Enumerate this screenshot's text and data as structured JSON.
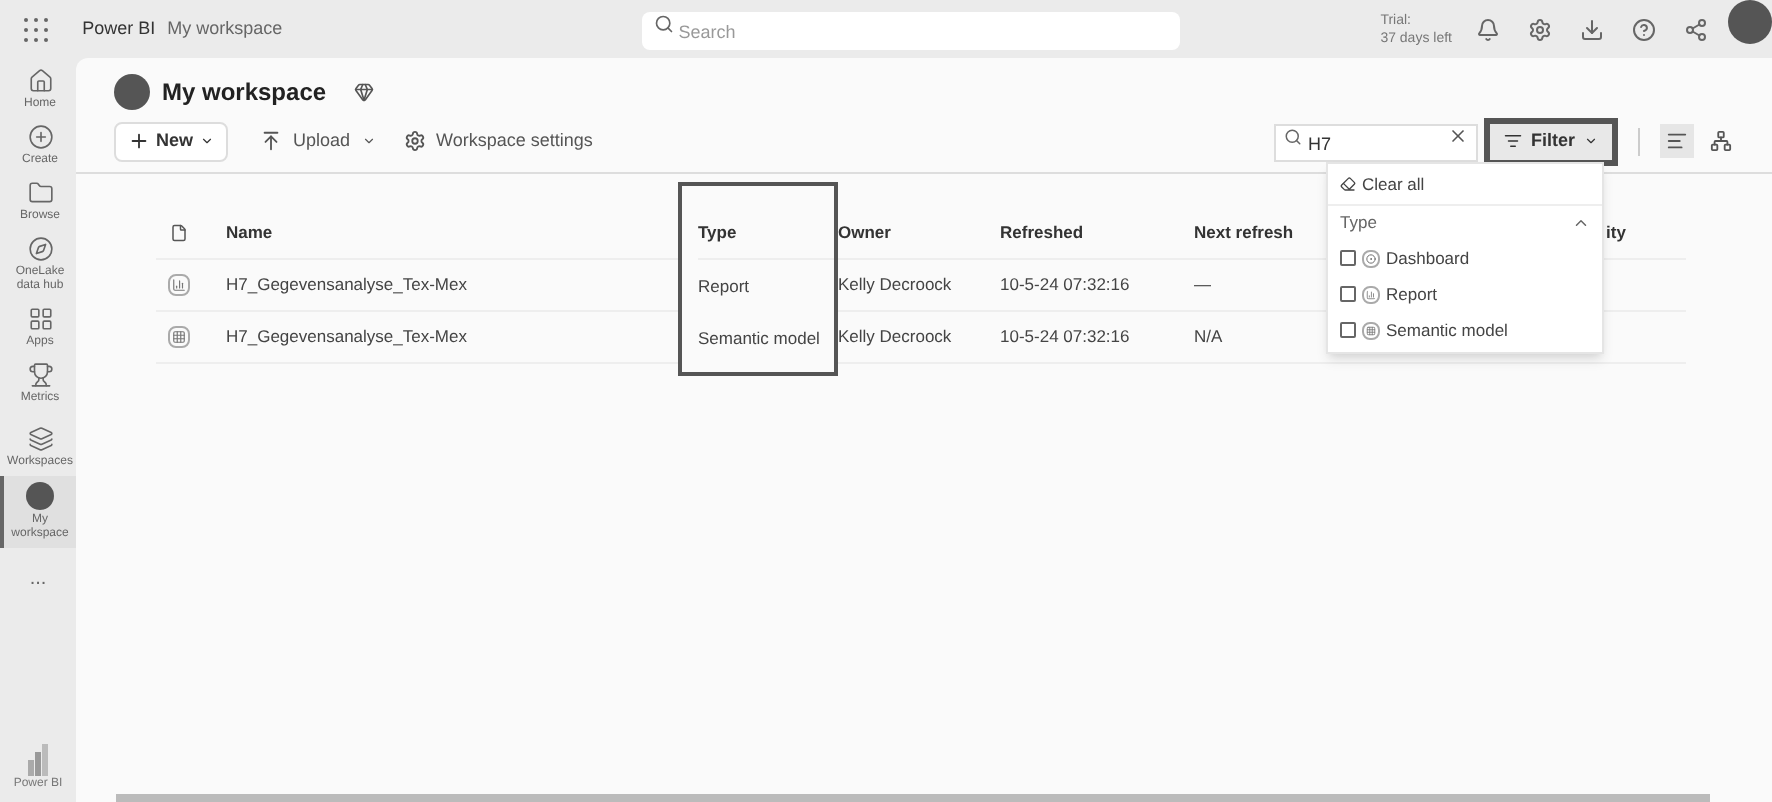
{
  "topbar": {
    "brand": "Power BI",
    "breadcrumb": "My workspace",
    "search_placeholder": "Search",
    "trial": [
      "Trial:",
      "37 days left"
    ]
  },
  "rail": [
    {
      "label": "Home",
      "selected": false
    },
    {
      "label": "Create",
      "selected": false
    },
    {
      "label": "Browse",
      "selected": false
    },
    {
      "label": "OneLake data hub",
      "selected": false
    },
    {
      "label": "Apps",
      "selected": false
    },
    {
      "label": "Metrics",
      "selected": false
    },
    {
      "label": "Workspaces",
      "selected": false
    },
    {
      "label": "My workspace",
      "selected": true
    }
  ],
  "rail_more": "...",
  "rail_footer": "Power BI",
  "header": {
    "title": "My workspace"
  },
  "toolbar": {
    "new": "New",
    "upload": "Upload",
    "settings": "Workspace settings",
    "filter_search": "H7",
    "filter": {
      "label": "Filter",
      "highlighted": true
    }
  },
  "table": {
    "columns": [
      {
        "label": "Name",
        "highlighted": false
      },
      {
        "label": "Type",
        "highlighted": true
      },
      {
        "label": "Owner",
        "highlighted": false
      },
      {
        "label": "Refreshed",
        "highlighted": false
      },
      {
        "label": "Next refresh",
        "highlighted": false
      },
      {
        "label": "ity",
        "highlighted": false
      }
    ],
    "rows": [
      {
        "kind": "report",
        "cells": [
          "H7_Gegevensanalyse_Tex-Mex",
          "Report",
          "Kelly Decroock",
          "10-5-24 07:32:16",
          "—"
        ]
      },
      {
        "kind": "model",
        "cells": [
          "H7_Gegevensanalyse_Tex-Mex",
          "Semantic model",
          "Kelly Decroock",
          "10-5-24 07:32:16",
          "N/A"
        ]
      }
    ]
  },
  "filter_menu": {
    "clear": "Clear all",
    "section": "Type",
    "expanded": true,
    "options": [
      {
        "kind": "dashboard",
        "label": "Dashboard",
        "checked": false
      },
      {
        "kind": "report",
        "label": "Report",
        "checked": false
      },
      {
        "kind": "model",
        "label": "Semantic model",
        "checked": false
      }
    ]
  }
}
